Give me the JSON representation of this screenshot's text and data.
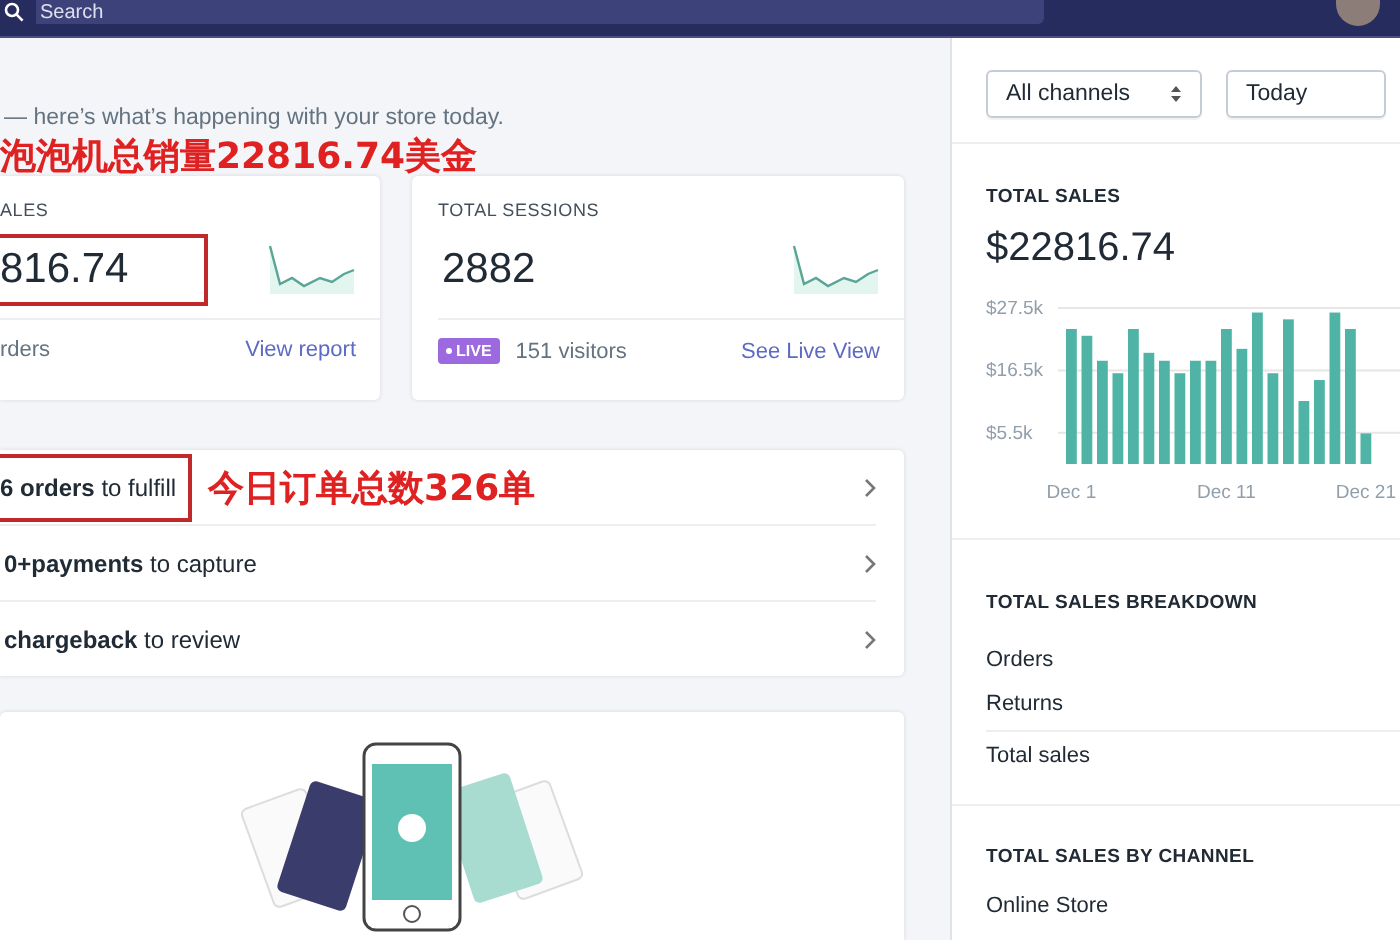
{
  "topbar": {
    "search_placeholder": "Search"
  },
  "greeting": "— here’s what’s happening with your store today.",
  "sales_annotation": "泡泡机总销量22816.74美金",
  "metric_cards": [
    {
      "label": "ALES",
      "value": "816.74",
      "footer_text": "rders",
      "link": "View report",
      "highlighted": true
    },
    {
      "label": "TOTAL SESSIONS",
      "value": "2882",
      "badge": "LIVE",
      "footer_text": "151 visitors",
      "link": "See Live View",
      "highlighted": false
    }
  ],
  "tasks": {
    "annotation": "今日订单总数326单",
    "items": [
      {
        "text": "**6 orders** to fulfill",
        "highlighted": true
      },
      {
        "text": "**0+payments** to capture",
        "highlighted": false
      },
      {
        "text": "**chargeback** to review",
        "highlighted": false
      }
    ]
  },
  "filters": [
    {
      "value": "All channels",
      "kind": "select"
    },
    {
      "value": "Today",
      "kind": "plain"
    }
  ],
  "total_sales": {
    "title": "TOTAL SALES",
    "value": "$22816.74",
    "chart_data": {
      "type": "bar",
      "categories": [
        "Dec 1",
        null,
        null,
        null,
        null,
        null,
        null,
        null,
        null,
        null,
        "Dec 11",
        null,
        null,
        null,
        null,
        null,
        null,
        null,
        null,
        "Dec 21"
      ],
      "values": [
        23.8,
        22.6,
        18.2,
        16.0,
        23.8,
        19.6,
        18.2,
        16.0,
        18.2,
        18.2,
        23.8,
        20.3,
        26.7,
        16.0,
        25.5,
        11.1,
        14.8,
        26.7,
        23.8,
        5.4
      ],
      "ylim": [
        0,
        27.5
      ],
      "yticks": [
        {
          "value": 5.5,
          "label": "$5.5k"
        },
        {
          "value": 16.5,
          "label": "$16.5k"
        },
        {
          "value": 27.5,
          "label": "$27.5k"
        }
      ]
    }
  },
  "breakdown": {
    "title": "TOTAL SALES BREAKDOWN",
    "rows": [
      {
        "label": "Orders",
        "kind": "line"
      },
      {
        "label": "Returns",
        "kind": "line"
      },
      {
        "label": "Total sales",
        "kind": "total"
      }
    ]
  },
  "by_channel": {
    "title": "TOTAL SALES BY CHANNEL",
    "rows": [
      {
        "label": "Online Store",
        "kind": "line"
      }
    ]
  }
}
